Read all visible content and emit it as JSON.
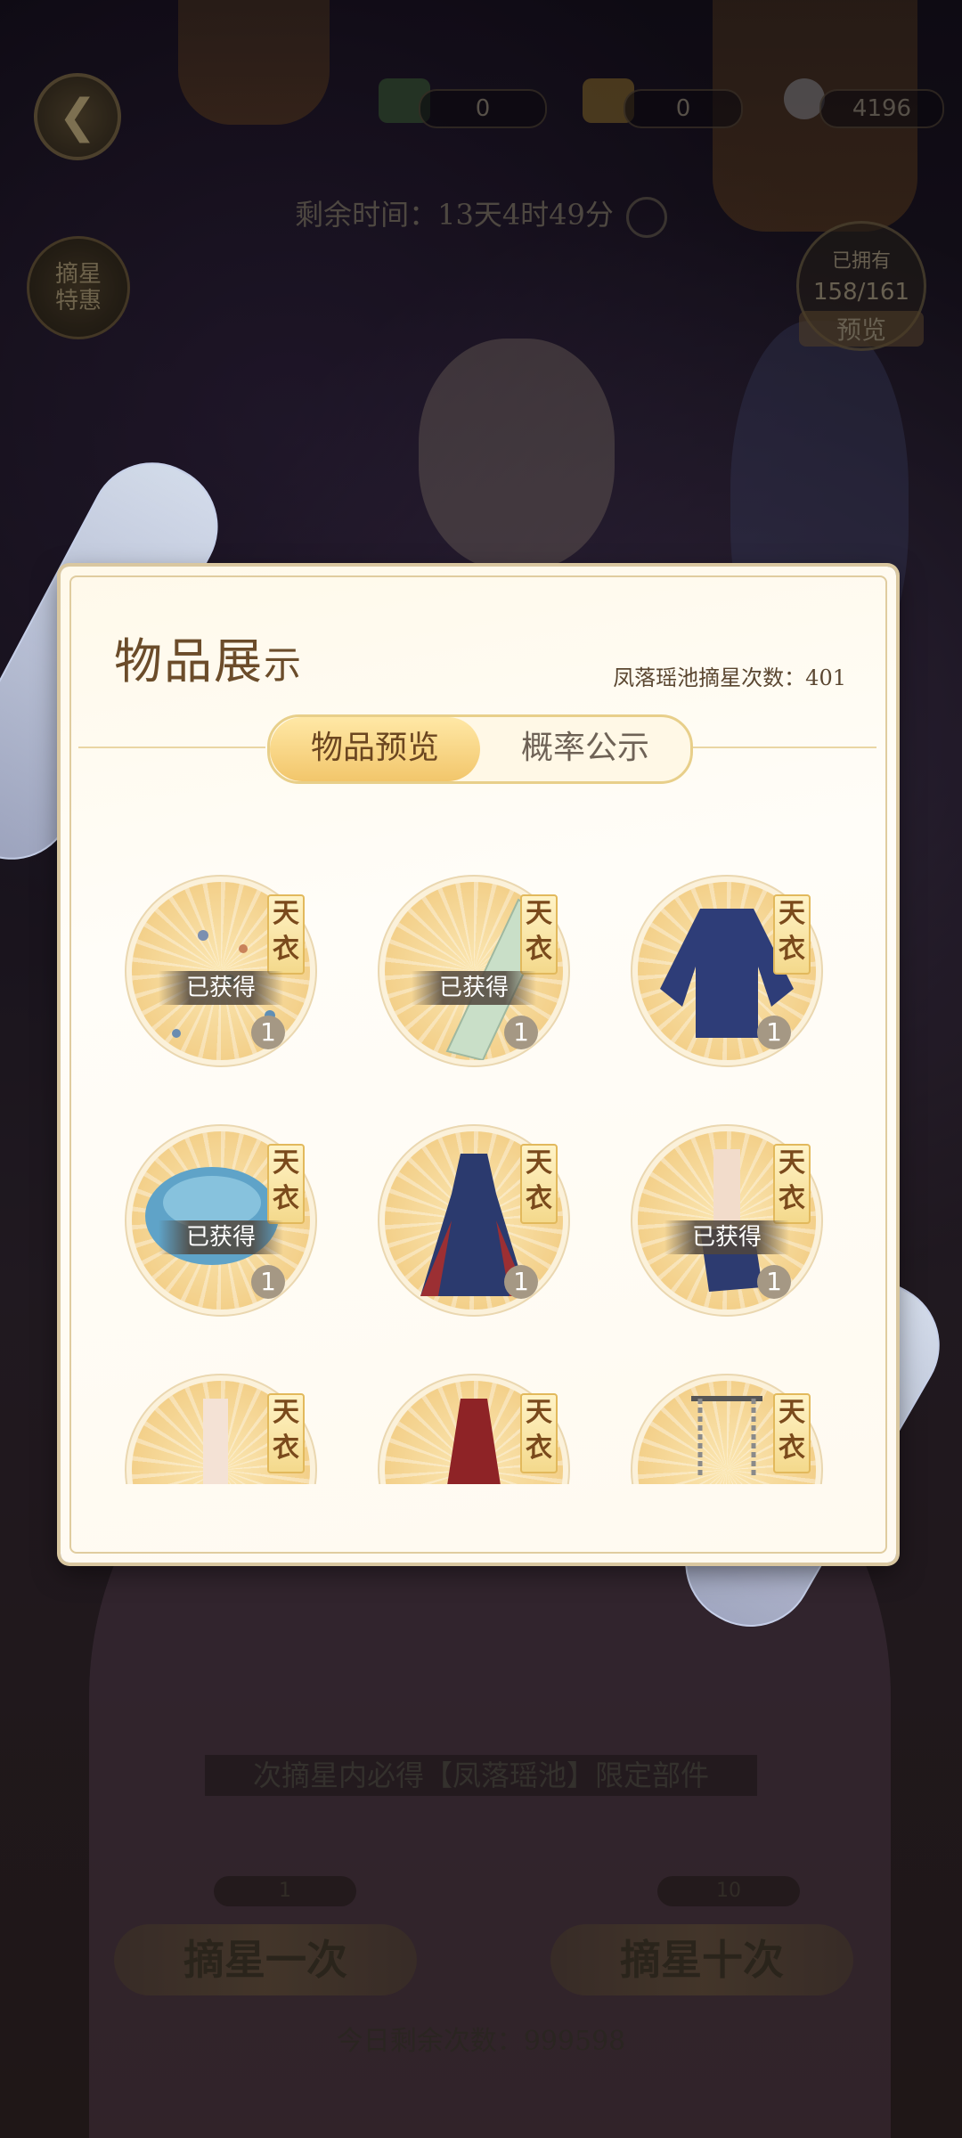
{
  "topbar": {
    "currency_1": "0",
    "currency_2": "0",
    "currency_3": "4196",
    "remaining_time": "剩余时间：13天4时49分"
  },
  "side": {
    "star_deal_line1": "摘星",
    "star_deal_line2": "特惠",
    "obtained_label": "已拥有",
    "collection_progress": "158/161",
    "preview_label": "预览"
  },
  "modal": {
    "title_main": "物品展",
    "title_tail": "示",
    "pool_draw_count": "凤落瑶池摘星次数：401",
    "tabs": [
      {
        "label": "物品预览",
        "active": true
      },
      {
        "label": "概率公示",
        "active": false
      }
    ],
    "items": [
      {
        "tag": "天衣",
        "owned_label": "已获得",
        "count": "1",
        "art": "butterflies"
      },
      {
        "tag": "天衣",
        "owned_label": "已获得",
        "count": "1",
        "art": "fabric"
      },
      {
        "tag": "天衣",
        "owned_label": "",
        "count": "1",
        "art": "blue-top"
      },
      {
        "tag": "天衣",
        "owned_label": "已获得",
        "count": "1",
        "art": "headdress"
      },
      {
        "tag": "天衣",
        "owned_label": "",
        "count": "1",
        "art": "dress"
      },
      {
        "tag": "天衣",
        "owned_label": "已获得",
        "count": "1",
        "art": "shoe"
      },
      {
        "tag": "天衣",
        "owned_label": "",
        "count": "",
        "art": "leg"
      },
      {
        "tag": "天衣",
        "owned_label": "",
        "count": "",
        "art": "skirt"
      },
      {
        "tag": "天衣",
        "owned_label": "",
        "count": "",
        "art": "necklace"
      }
    ]
  },
  "bottom": {
    "guarantee_text": "次摘星内必得【凤落瑶池】限定部件",
    "draw_once_cost": "1",
    "draw_once_label": "摘星一次",
    "draw_ten_cost": "10",
    "draw_ten_label": "摘星十次",
    "daily_remaining": "今日剩余次数：999598"
  },
  "colors": {
    "accent_gold": "#f2c66b",
    "title_brown": "#6b4c2a",
    "owned_bar": "#50463c",
    "count_badge": "#a59884"
  }
}
